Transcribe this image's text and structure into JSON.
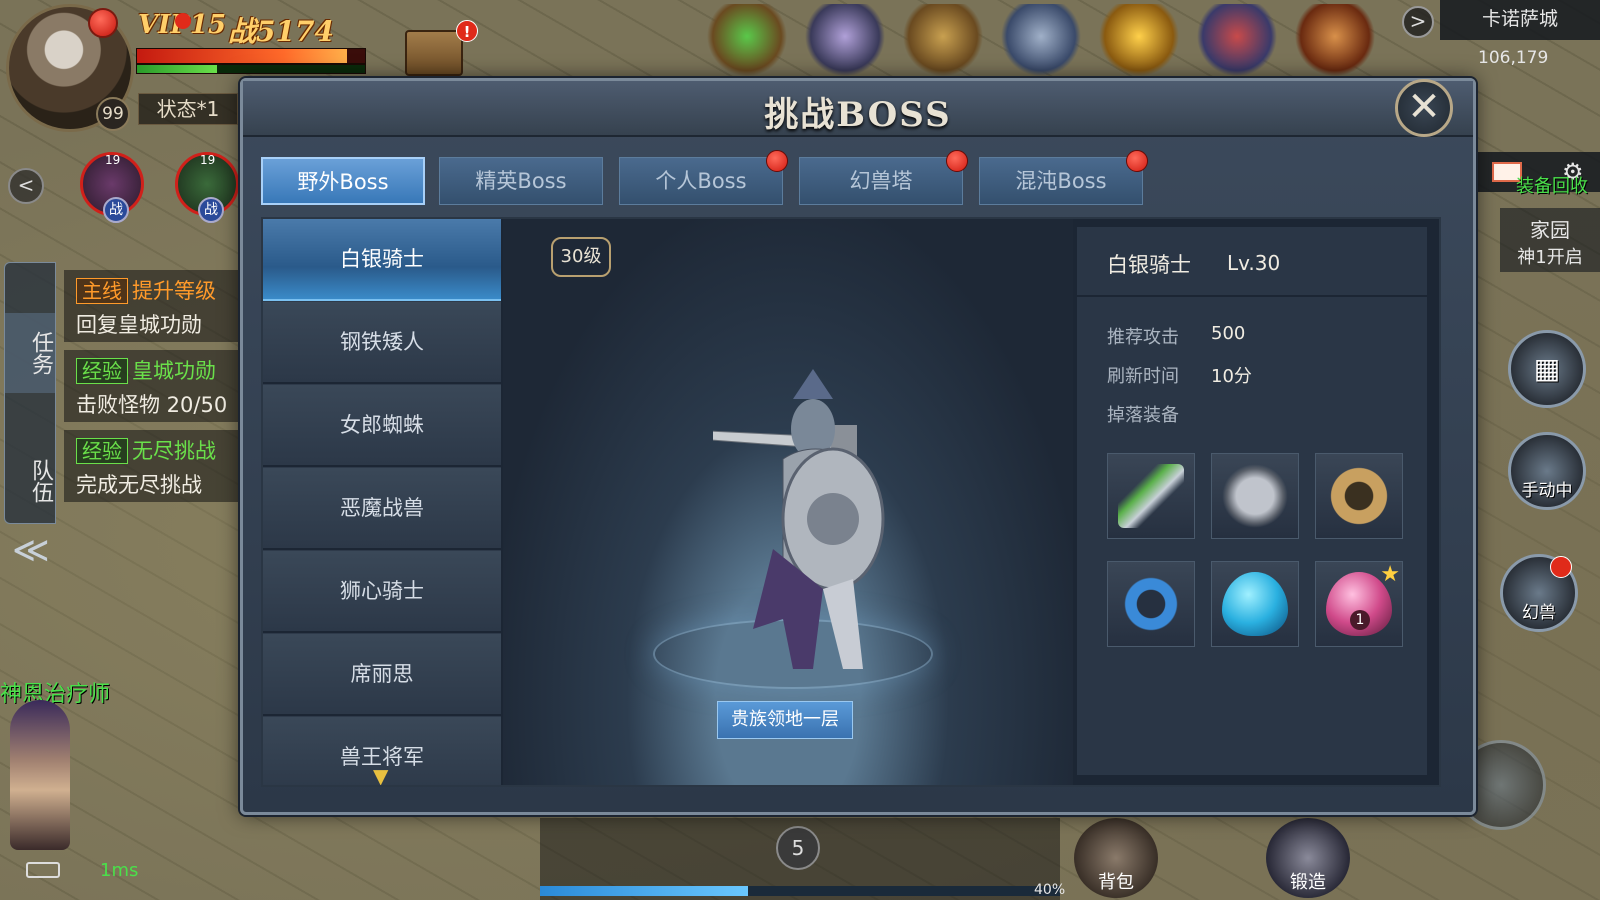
{
  "hud": {
    "vip": "VIP15",
    "power": "战5174",
    "player_level": "99",
    "status": "状态*1",
    "party": [
      {
        "level": "19",
        "tag": "战"
      },
      {
        "level": "19",
        "tag": "战"
      }
    ],
    "hp_fraction": 0.92,
    "mp_fraction": 0.35
  },
  "quests": {
    "side_tabs": [
      "任务",
      "队伍"
    ],
    "items": [
      {
        "tag": "主线",
        "title": "提升等级",
        "desc": "回复皇城功勋",
        "kind": "main"
      },
      {
        "tag": "经验",
        "title": "皇城功勋",
        "desc": "击败怪物 20/50",
        "kind": "exp"
      },
      {
        "tag": "经验",
        "title": "无尽挑战",
        "desc": "完成无尽挑战",
        "kind": "exp"
      }
    ]
  },
  "npc_name": "神恩治疗师",
  "ping": "1ms",
  "map": {
    "name": "卡诺萨城",
    "coords": "106,179"
  },
  "right_hud": {
    "side_note": "装备回收",
    "home_title": "家园",
    "home_sub": "神1开启",
    "manual_label": "手动中",
    "beast_label": "幻兽"
  },
  "bottom": {
    "stage": "5",
    "exp_percent_label": "40%",
    "exp_fraction": 0.4,
    "bag_label": "背包",
    "forge_label": "锻造"
  },
  "dialog": {
    "title": "挑战BOSS",
    "close_symbol": "✕",
    "tabs": [
      {
        "label": "野外Boss",
        "active": true,
        "dot": false
      },
      {
        "label": "精英Boss",
        "active": false,
        "dot": false
      },
      {
        "label": "个人Boss",
        "active": false,
        "dot": true
      },
      {
        "label": "幻兽塔",
        "active": false,
        "dot": true
      },
      {
        "label": "混沌Boss",
        "active": false,
        "dot": true
      }
    ],
    "bosses": [
      {
        "name": "白银骑士",
        "active": true
      },
      {
        "name": "钢铁矮人",
        "active": false
      },
      {
        "name": "女郎蜘蛛",
        "active": false
      },
      {
        "name": "恶魔战兽",
        "active": false
      },
      {
        "name": "狮心骑士",
        "active": false
      },
      {
        "name": "席丽思",
        "active": false
      },
      {
        "name": "兽王将军",
        "active": false
      }
    ],
    "preview": {
      "level_badge": "30级",
      "location_button": "贵族领地一层"
    },
    "info": {
      "name": "白银骑士",
      "level": "Lv.30",
      "attack_label": "推荐攻击",
      "attack_value": "500",
      "refresh_label": "刷新时间",
      "refresh_value": "10分",
      "drops_label": "掉落装备",
      "drops": [
        {
          "icon": "sword-icon",
          "color": "#5ab04a"
        },
        {
          "icon": "armor-icon",
          "color": "#a0a0a8"
        },
        {
          "icon": "bracer-icon",
          "color": "#c8a060"
        },
        {
          "icon": "ring-icon",
          "color": "#3a8ad8"
        },
        {
          "icon": "blue-egg-icon",
          "color": "#2ab0e0"
        },
        {
          "icon": "pink-egg-icon",
          "color": "#d04a8a",
          "count": "1",
          "star": true
        }
      ]
    }
  },
  "colors": {
    "active_tab": "#3878b8",
    "panel_bg": "#2c3848",
    "alert_red": "#d01a10"
  }
}
